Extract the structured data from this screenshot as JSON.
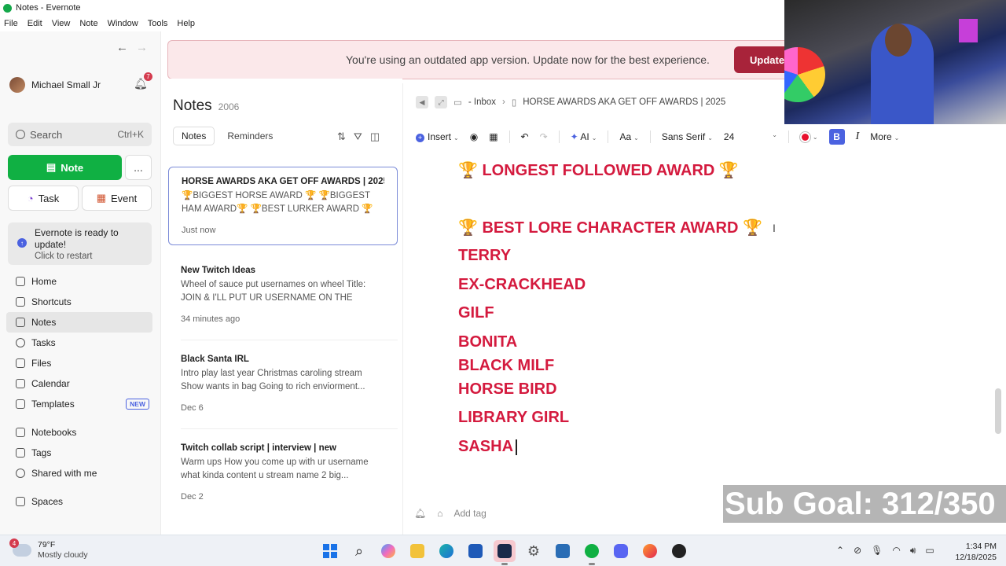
{
  "window": {
    "title": "Notes - Evernote"
  },
  "menu": [
    "File",
    "Edit",
    "View",
    "Note",
    "Window",
    "Tools",
    "Help"
  ],
  "sidebar": {
    "user_name": "Michael Small Jr",
    "notification_count": "7",
    "search_placeholder": "Search",
    "search_shortcut": "Ctrl+K",
    "note_button": "Note",
    "more_button": "...",
    "task_button": "Task",
    "event_button": "Event",
    "update_title": "Evernote is ready to update!",
    "update_sub": "Click to restart",
    "items": [
      {
        "label": "Home",
        "icon": "home-icon"
      },
      {
        "label": "Shortcuts",
        "icon": "star-icon"
      },
      {
        "label": "Notes",
        "icon": "note-icon",
        "active": true
      },
      {
        "label": "Tasks",
        "icon": "check-icon"
      },
      {
        "label": "Files",
        "icon": "file-icon"
      },
      {
        "label": "Calendar",
        "icon": "calendar-icon"
      },
      {
        "label": "Templates",
        "icon": "template-icon",
        "badge": "NEW"
      },
      {
        "label": "Notebooks",
        "icon": "notebook-icon"
      },
      {
        "label": "Tags",
        "icon": "tag-icon"
      },
      {
        "label": "Shared with me",
        "icon": "people-icon"
      },
      {
        "label": "Spaces",
        "icon": "spaces-icon"
      }
    ]
  },
  "banner": {
    "message": "You're using an outdated app version. Update now for the best experience.",
    "button": "Update"
  },
  "notes_list": {
    "title": "Notes",
    "count": "2006",
    "tabs": [
      "Notes",
      "Reminders"
    ],
    "notes": [
      {
        "title": "HORSE AWARDS AKA GET OFF AWARDS | 2025",
        "preview": "🏆BIGGEST HORSE AWARD 🏆 🏆BIGGEST HAM AWARD🏆 🏆BEST LURKER AWARD 🏆 🏆...",
        "date": "Just now"
      },
      {
        "title": "New Twitch Ideas",
        "preview": "Wheel of sauce put usernames on wheel Title: JOIN & I'LL PUT UR USERNAME ON THE WHEEL...",
        "date": "34 minutes ago"
      },
      {
        "title": "Black Santa IRL",
        "preview": "Intro play last year Christmas caroling stream Show wants in bag Going to rich enviorment...",
        "date": "Dec 6"
      },
      {
        "title": "Twitch collab script | interview | new",
        "preview": "Warm ups How you come up with ur username what kinda content u stream name 2 big...",
        "date": "Dec 2"
      }
    ]
  },
  "editor": {
    "breadcrumb_notebook": "- Inbox",
    "breadcrumb_note": "HORSE AWARDS AKA GET OFF AWARDS | 2025",
    "toolbar": {
      "insert": "Insert",
      "ai": "AI",
      "font_style": "Aa",
      "font_family": "Sans Serif",
      "font_size": "24",
      "bold": "B",
      "italic": "I",
      "more": "More"
    },
    "text_color": "#e8102d",
    "headings": [
      "🏆 LONGEST FOLLOWED AWARD 🏆",
      "🏆 BEST LORE CHARACTER AWARD 🏆"
    ],
    "names": [
      "TERRY",
      "EX-CRACKHEAD",
      "GILF",
      "BONITA",
      "BLACK MILF",
      "HORSE BIRD",
      "LIBRARY GIRL",
      "SASHA"
    ],
    "add_tag": "Add tag"
  },
  "overlay": {
    "sub_goal": "Sub Goal: 312/350"
  },
  "taskbar": {
    "weather_badge": "4",
    "temperature": "79°F",
    "weather_desc": "Mostly cloudy",
    "time": "1:34 PM",
    "date": "12/18/2025"
  }
}
